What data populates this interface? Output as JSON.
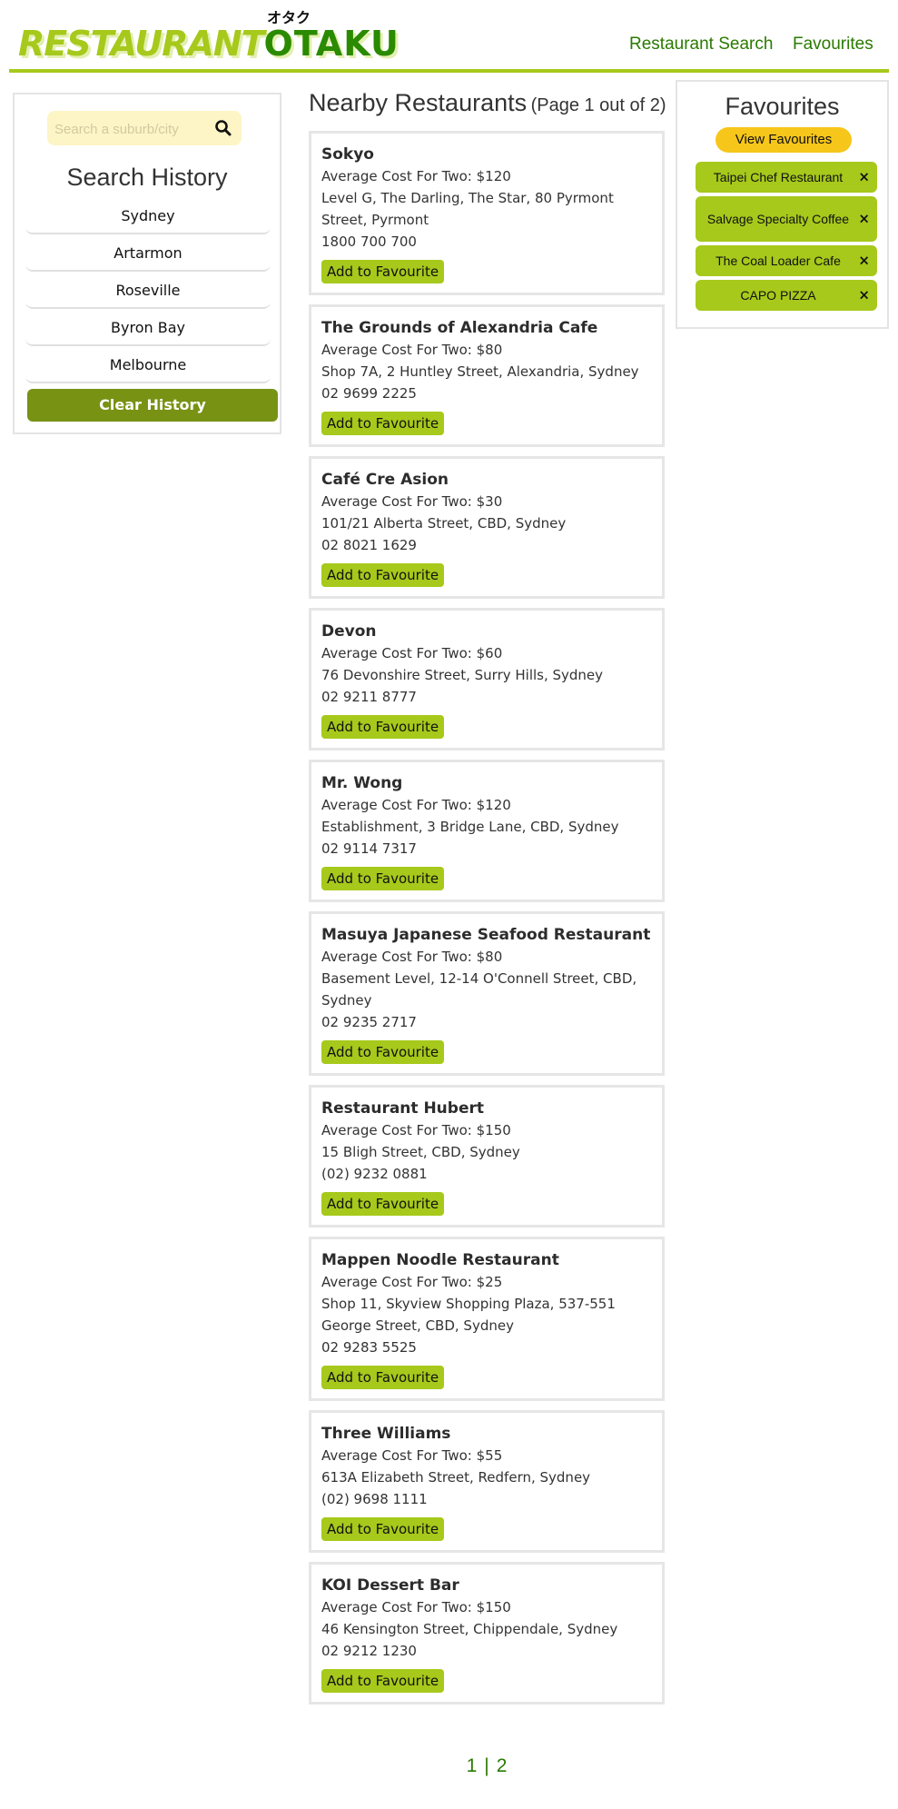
{
  "header": {
    "logo_part1": "RESTAURANT",
    "logo_part2": "OTAKU",
    "logo_kana": "オタク",
    "nav": [
      "Restaurant Search",
      "Favourites"
    ]
  },
  "search": {
    "placeholder": "Search a suburb/city",
    "icon": "search-icon"
  },
  "history": {
    "title": "Search History",
    "items": [
      "Sydney",
      "Artarmon",
      "Roseville",
      "Byron Bay",
      "Melbourne"
    ],
    "clear_label": "Clear History"
  },
  "results": {
    "title": "Nearby Restaurants",
    "page_info": "(Page 1 out of 2)",
    "add_label": "Add to Favourite",
    "restaurants": [
      {
        "name": "Sokyo",
        "cost": "Average Cost For Two: $120",
        "address": "Level G, The Darling, The Star, 80 Pyrmont Street, Pyrmont",
        "phone": "1800 700 700"
      },
      {
        "name": "The Grounds of Alexandria Cafe",
        "cost": "Average Cost For Two: $80",
        "address": "Shop 7A, 2 Huntley Street, Alexandria, Sydney",
        "phone": "02 9699 2225"
      },
      {
        "name": "Café Cre Asion",
        "cost": "Average Cost For Two: $30",
        "address": "101/21 Alberta Street, CBD, Sydney",
        "phone": "02 8021 1629"
      },
      {
        "name": "Devon",
        "cost": "Average Cost For Two: $60",
        "address": "76 Devonshire Street, Surry Hills, Sydney",
        "phone": "02 9211 8777"
      },
      {
        "name": "Mr. Wong",
        "cost": "Average Cost For Two: $120",
        "address": "Establishment, 3 Bridge Lane, CBD, Sydney",
        "phone": "02 9114 7317"
      },
      {
        "name": "Masuya Japanese Seafood Restaurant",
        "cost": "Average Cost For Two: $80",
        "address": "Basement Level, 12-14 O'Connell Street, CBD, Sydney",
        "phone": "02 9235 2717"
      },
      {
        "name": "Restaurant Hubert",
        "cost": "Average Cost For Two: $150",
        "address": "15 Bligh Street, CBD, Sydney",
        "phone": "(02) 9232 0881"
      },
      {
        "name": "Mappen Noodle Restaurant",
        "cost": "Average Cost For Two: $25",
        "address": "Shop 11, Skyview Shopping Plaza, 537-551 George Street, CBD, Sydney",
        "phone": "02 9283 5525"
      },
      {
        "name": "Three Williams",
        "cost": "Average Cost For Two: $55",
        "address": "613A Elizabeth Street, Redfern, Sydney",
        "phone": "(02) 9698 1111"
      },
      {
        "name": "KOI Dessert Bar",
        "cost": "Average Cost For Two: $150",
        "address": "46 Kensington Street, Chippendale, Sydney",
        "phone": "02 9212 1230"
      }
    ]
  },
  "pagination": {
    "pages": [
      "1",
      "2"
    ],
    "separator": "|"
  },
  "favourites": {
    "title": "Favourites",
    "view_label": "View Favourites",
    "remove_symbol": "×",
    "items": [
      "Taipei Chef Restaurant",
      "Salvage Specialty Coffee",
      "The Coal Loader Cafe",
      "CAPO PIZZA"
    ]
  },
  "colors": {
    "accent": "#a6c91b",
    "dark_green": "#789214",
    "link": "#2a7a00",
    "yellow": "#f6c61a"
  }
}
